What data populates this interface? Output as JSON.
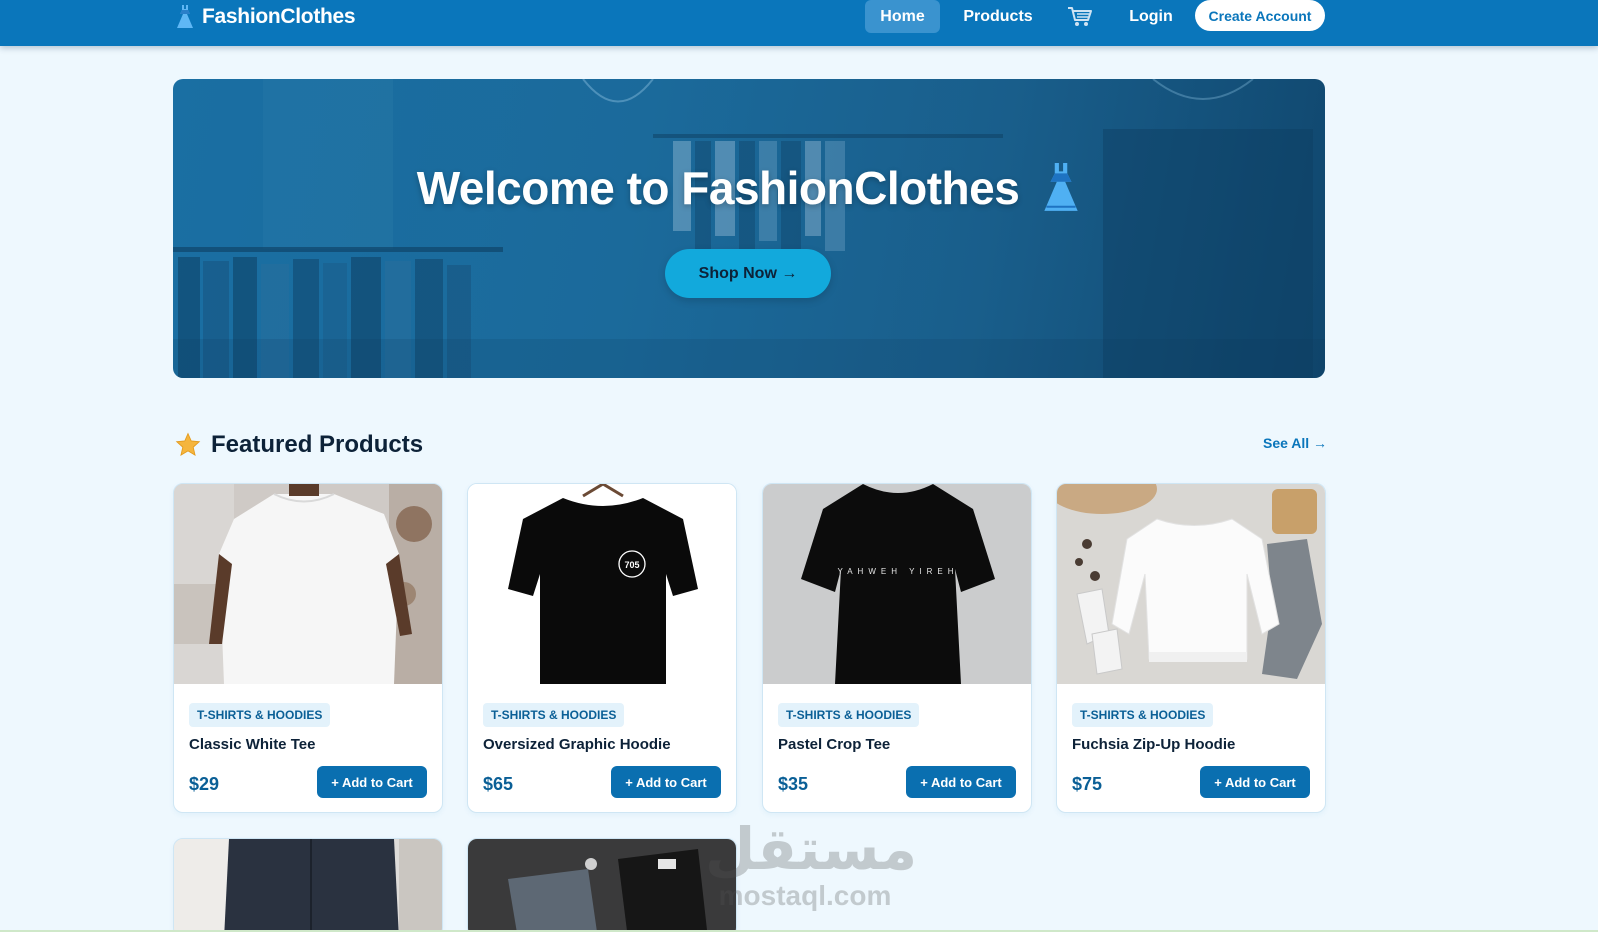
{
  "brand": {
    "name": "FashionClothes",
    "logo_icon": "dress-icon"
  },
  "nav": {
    "home": "Home",
    "products": "Products",
    "cart_icon": "cart-icon",
    "login": "Login",
    "create_account": "Create Account"
  },
  "hero": {
    "title": "Welcome to FashionClothes",
    "title_icon": "dress-icon",
    "cta": "Shop Now →"
  },
  "featured": {
    "title": "Featured Products",
    "title_icon": "star-icon",
    "see_all": "See All →",
    "products": [
      {
        "category": "T-SHIRTS & HOODIES",
        "name": "Classic White Tee",
        "price": "$29",
        "add_label": "+ Add to Cart"
      },
      {
        "category": "T-SHIRTS & HOODIES",
        "name": "Oversized Graphic Hoodie",
        "price": "$65",
        "add_label": "+ Add to Cart"
      },
      {
        "category": "T-SHIRTS & HOODIES",
        "name": "Pastel Crop Tee",
        "price": "$35",
        "add_label": "+ Add to Cart"
      },
      {
        "category": "T-SHIRTS & HOODIES",
        "name": "Fuchsia Zip-Up Hoodie",
        "price": "$75",
        "add_label": "+ Add to Cart"
      }
    ]
  },
  "product_print": {
    "badge": "705",
    "tee_text": "YAHWEH YIREH"
  },
  "watermark": {
    "arabic": "مستقل",
    "latin": "mostaql.com"
  },
  "colors": {
    "primary": "#0a76bb",
    "accent": "#12a9dc",
    "background": "#eef8fe"
  }
}
